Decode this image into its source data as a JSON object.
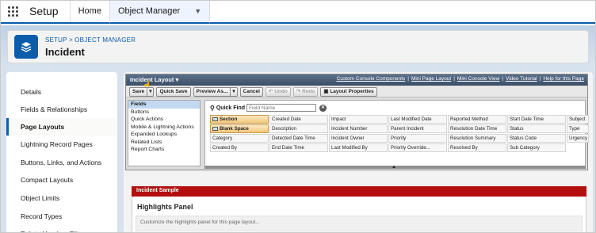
{
  "topnav": {
    "app_name": "Setup",
    "tabs": [
      {
        "label": "Home"
      },
      {
        "label": "Object Manager"
      }
    ]
  },
  "header": {
    "breadcrumb": "SETUP > OBJECT MANAGER",
    "title": "Incident"
  },
  "sidebar": {
    "items": [
      {
        "label": "Details"
      },
      {
        "label": "Fields & Relationships"
      },
      {
        "label": "Page Layouts"
      },
      {
        "label": "Lightning Record Pages"
      },
      {
        "label": "Buttons, Links, and Actions"
      },
      {
        "label": "Compact Layouts"
      },
      {
        "label": "Object Limits"
      },
      {
        "label": "Record Types"
      },
      {
        "label": "Related Lookup Filters"
      }
    ],
    "active_index": 2
  },
  "editor": {
    "title": "Incident Layout",
    "links": [
      "Custom Console Components",
      "Mini Page Layout",
      "Mini Console View",
      "Video Tutorial",
      "Help for this Page"
    ],
    "toolbar": {
      "save": "Save",
      "quick_save": "Quick Save",
      "preview_as": "Preview As...",
      "cancel": "Cancel",
      "undo": "Undo",
      "redo": "Redo",
      "layout_properties": "Layout Properties"
    },
    "categories": [
      "Fields",
      "Buttons",
      "Quick Actions",
      "Mobile & Lightning Actions",
      "Expanded Lookups",
      "Related Lists",
      "Report Charts"
    ],
    "quick_find": {
      "label": "Quick Find",
      "placeholder": "Field Name"
    },
    "fields": [
      "Section",
      "Created Date",
      "Impact",
      "Last Modified Date",
      "Reported Method",
      "Start Date Time",
      "Subject",
      "Blank Space",
      "Description",
      "Incident Number",
      "Parent Incident",
      "Resolution Date Time",
      "Status",
      "Type",
      "Category",
      "Detected Date Time",
      "Incident Owner",
      "Priority",
      "Resolution Summary",
      "Status Code",
      "Urgency",
      "Created By",
      "End Date Time",
      "Last Modified By",
      "Priority Override...",
      "Resolved By",
      "Sub Category",
      ""
    ]
  },
  "canvas": {
    "sample_label": "Incident Sample",
    "highlights_title": "Highlights Panel",
    "highlights_hint": "Customize the highlights panel for this page layout..."
  }
}
